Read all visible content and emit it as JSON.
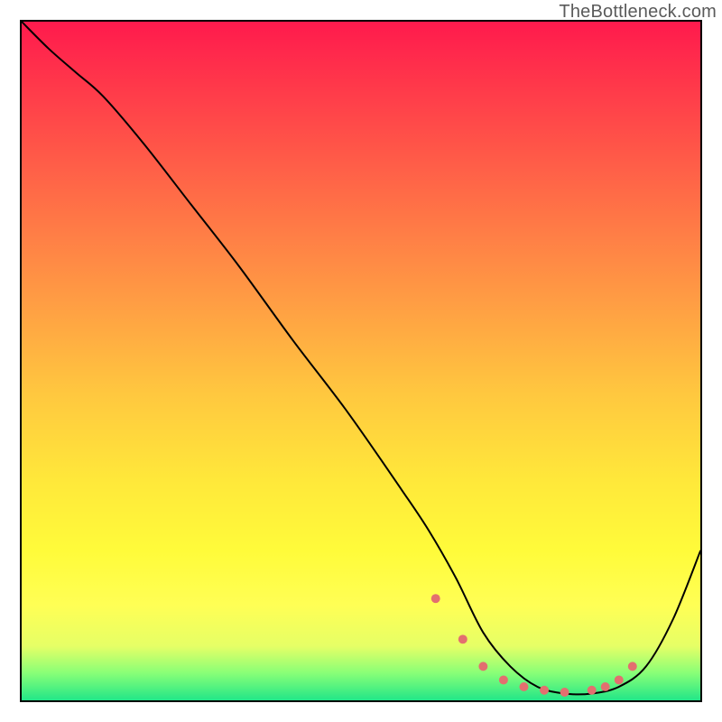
{
  "watermark": "TheBottleneck.com",
  "chart_data": {
    "type": "line",
    "title": "",
    "xlabel": "",
    "ylabel": "",
    "xlim": [
      0,
      100
    ],
    "ylim": [
      0,
      100
    ],
    "series": [
      {
        "name": "bottleneck-curve",
        "x": [
          0,
          4,
          8,
          12,
          18,
          25,
          32,
          40,
          48,
          56,
          60,
          64,
          68,
          72,
          76,
          80,
          84,
          88,
          92,
          96,
          100
        ],
        "y": [
          100,
          96,
          92.5,
          89,
          82,
          73,
          64,
          53,
          42.5,
          31,
          25,
          18,
          10,
          5,
          2,
          1,
          1,
          2,
          5,
          12,
          22
        ]
      }
    ],
    "markers": {
      "name": "marker-dots",
      "color": "#e36f6f",
      "x": [
        61,
        65,
        68,
        71,
        74,
        77,
        80,
        84,
        86,
        88,
        90
      ],
      "y": [
        15,
        9,
        5,
        3,
        2,
        1.5,
        1.2,
        1.5,
        2,
        3,
        5
      ]
    },
    "gradient_stops": [
      {
        "pos": 0,
        "color": "#ff1a4d"
      },
      {
        "pos": 100,
        "color": "#22e688"
      }
    ]
  }
}
